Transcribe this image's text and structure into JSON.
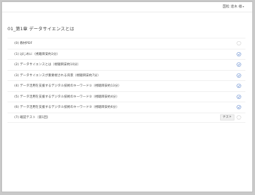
{
  "header": {
    "user_name": "国松 達木 様",
    "chevron": "chevron-down-icon"
  },
  "chapter": {
    "title": "01_第1章 データサイエンスとは"
  },
  "items": [
    {
      "label": "(0) 教材PDF",
      "status": "pending",
      "badge": ""
    },
    {
      "label": "(1) はじめに（視聴目安約3分）",
      "status": "done",
      "badge": ""
    },
    {
      "label": "(2) データサイエンスとは（視聴目安約10分）",
      "status": "done",
      "badge": ""
    },
    {
      "label": "(3) データサイエンスが重要視される背景（視聴目安約7分）",
      "status": "done",
      "badge": ""
    },
    {
      "label": "(4) データ活用を支援するデジタル技術のキーワード①（視聴目安約13分）",
      "status": "done",
      "badge": ""
    },
    {
      "label": "(5) データ活用を支援するデジタル技術のキーワード②（視聴目安約4分）",
      "status": "done",
      "badge": ""
    },
    {
      "label": "(6) データ活用を支援するデジタル技術のキーワード③（視聴目安約6分）",
      "status": "done",
      "badge": ""
    },
    {
      "label": "(7) 確認テスト（第1回）",
      "status": "pending",
      "badge": "テスト"
    }
  ],
  "colors": {
    "done": "#6a8fd0",
    "pending": "#cfcfcf"
  }
}
